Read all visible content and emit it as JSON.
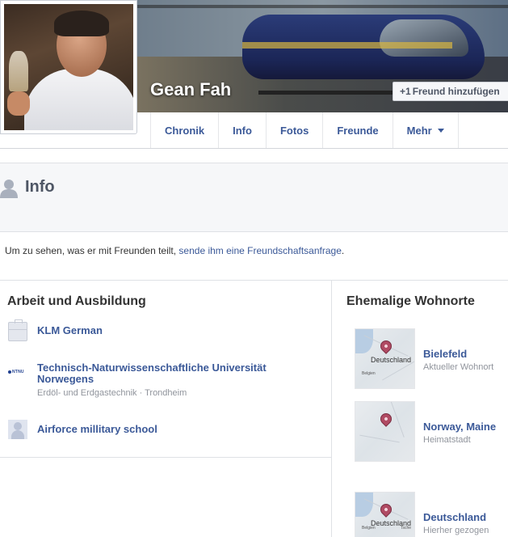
{
  "profile": {
    "name": "Gean Fah",
    "add_friend_label": "Freund hinzufügen",
    "add_friend_icon": "+1"
  },
  "nav": {
    "items": [
      {
        "label": "Chronik"
      },
      {
        "label": "Info"
      },
      {
        "label": "Fotos"
      },
      {
        "label": "Freunde"
      },
      {
        "label": "Mehr"
      }
    ]
  },
  "info": {
    "title": "Info"
  },
  "notice": {
    "text": "Um zu sehen, was er mit Freunden teilt, ",
    "link": "sende ihm eine Freundschaftsanfrage",
    "suffix": "."
  },
  "work": {
    "title": "Arbeit und Ausbildung",
    "entries": [
      {
        "name": "KLM German",
        "sub": "",
        "icon": "briefcase-icon"
      },
      {
        "name": "Technisch-Naturwissenschaftliche Universität Norwegens",
        "sub": "Erdöl- und Erdgastechnik · Trondheim",
        "icon": "ntnu-logo-icon",
        "icon_text": "NTNU"
      },
      {
        "name": "Airforce millitary school",
        "sub": "",
        "icon": "school-icon"
      }
    ]
  },
  "places": {
    "title": "Ehemalige Wohnorte",
    "entries": [
      {
        "name": "Bielefeld",
        "sub": "Aktueller Wohnort",
        "map_label": "Deutschland",
        "map_small": "Belgien"
      },
      {
        "name": "Norway, Maine",
        "sub": "Heimatstadt"
      },
      {
        "name": "Deutschland",
        "sub": "Hierher gezogen",
        "map_label": "Deutschland",
        "map_small": "Belgien",
        "map_small2": "Tsche"
      }
    ]
  },
  "colors": {
    "link": "#3b5998",
    "muted": "#90949c",
    "band": "#f6f7f9"
  }
}
